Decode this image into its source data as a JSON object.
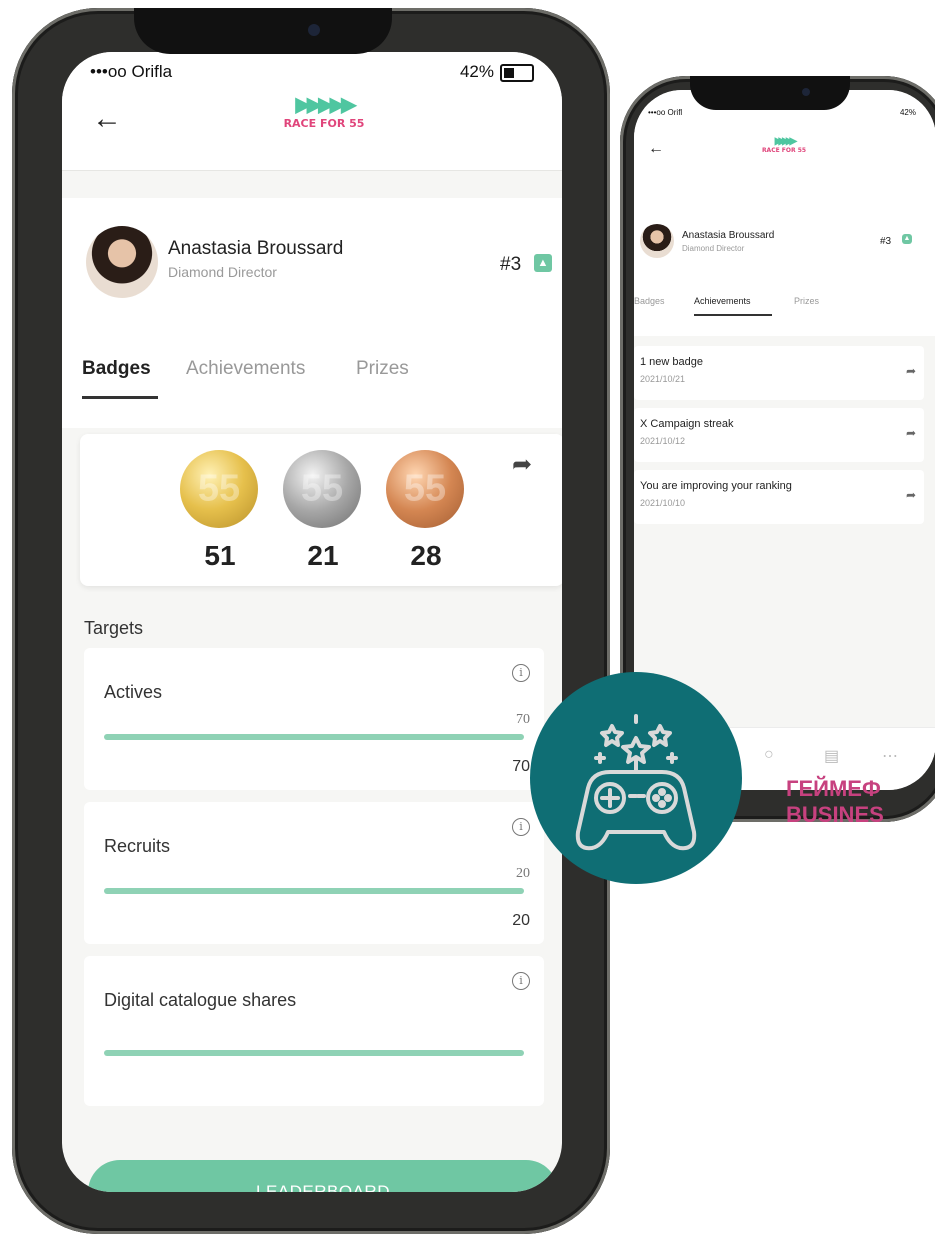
{
  "colors": {
    "accent": "#6fc7a3",
    "brand_pink": "#e0457b",
    "teal": "#0f6e74",
    "heading_pink": "#c7417f"
  },
  "main": {
    "status": {
      "carrier": "•••oo Orifla",
      "battery": "42%"
    },
    "logo": {
      "arrows": "▶▶▶▶▶",
      "text": "RACE FOR 55"
    },
    "profile": {
      "name": "Anastasia Broussard",
      "role": "Diamond Director",
      "rank": "#3"
    },
    "tabs": [
      {
        "label": "Badges"
      },
      {
        "label": "Achievements"
      },
      {
        "label": "Prizes"
      }
    ],
    "badges": [
      {
        "count": "51",
        "icon": "gold-medal"
      },
      {
        "count": "21",
        "icon": "silver-medal"
      },
      {
        "count": "28",
        "icon": "bronze-medal"
      }
    ],
    "targets_title": "Targets",
    "targets": [
      {
        "label": "Actives",
        "value_small": "70",
        "value": "70",
        "progress": 1.0
      },
      {
        "label": "Recruits",
        "value_small": "20",
        "value": "20",
        "progress": 1.0
      },
      {
        "label": "Digital catalogue shares",
        "value_small": "",
        "value": "",
        "progress": 1.0
      }
    ],
    "leaderboard": "LEADERBOARD"
  },
  "small": {
    "status": {
      "carrier": "•••oo Orifl",
      "battery": "42%"
    },
    "logo": {
      "arrows": "▶▶▶▶▶",
      "text": "RACE FOR 55"
    },
    "profile": {
      "name": "Anastasia Broussard",
      "role": "Diamond Director",
      "rank": "#3"
    },
    "tabs": [
      {
        "label": "Badges"
      },
      {
        "label": "Achievements"
      },
      {
        "label": "Prizes"
      }
    ],
    "items": [
      {
        "title": "1 new badge",
        "date": "2021/10/21"
      },
      {
        "title": "X Campaign streak",
        "date": "2021/10/12"
      },
      {
        "title": "You are improving your ranking",
        "date": "2021/10/10"
      }
    ],
    "nav": [
      {
        "icon": "home-icon"
      },
      {
        "icon": "bell-icon"
      },
      {
        "icon": "search-icon"
      },
      {
        "icon": "calendar-icon"
      },
      {
        "icon": "more-icon"
      }
    ]
  },
  "overlay": {
    "heading_line1": "ГЕЙМЕФ",
    "heading_line2": "BUSINES"
  }
}
